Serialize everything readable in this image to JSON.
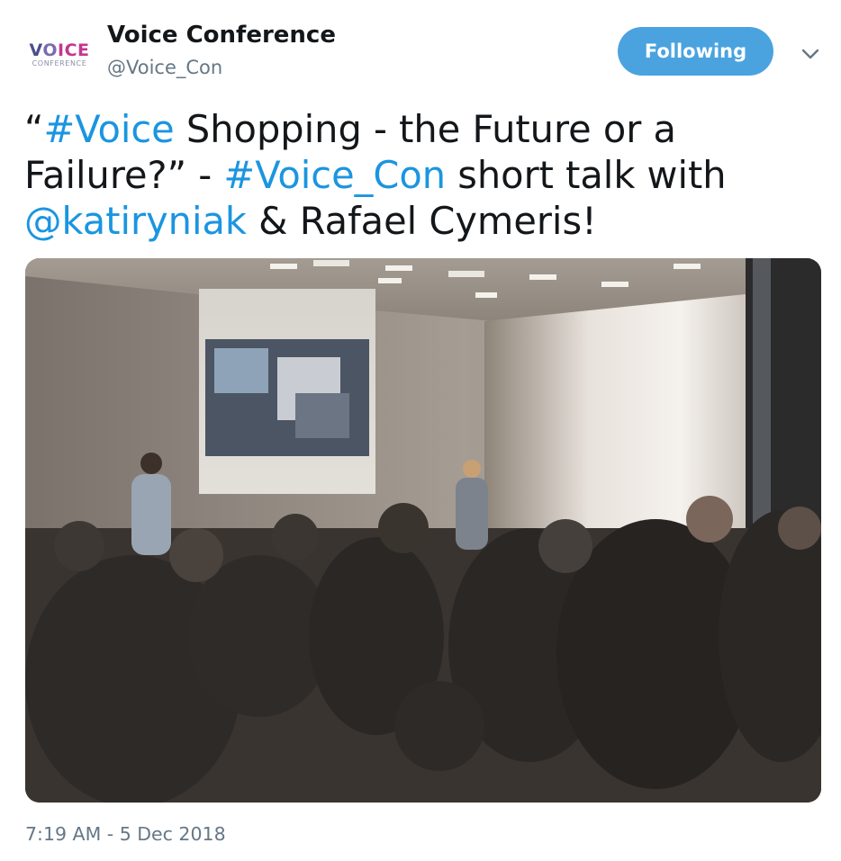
{
  "author": {
    "display_name": "Voice Conference",
    "handle": "@Voice_Con",
    "avatar": {
      "logo_word_1": "V",
      "logo_word_2": "O",
      "logo_word_3": "ICE",
      "logo_sub": "CONFERENCE"
    }
  },
  "follow_button": {
    "label": "Following",
    "color": "#4aa3df"
  },
  "menu": {
    "icon": "chevron-down-icon"
  },
  "tweet": {
    "segments": [
      {
        "text": "“",
        "link": false
      },
      {
        "text": "#Voice",
        "link": true
      },
      {
        "text": " Shopping - the Future or a Failure?” - ",
        "link": false
      },
      {
        "text": "#Voice_Con",
        "link": true
      },
      {
        "text": " short talk with ",
        "link": false
      },
      {
        "text": "@katiryniak",
        "link": true
      },
      {
        "text": " & Rafael Cymeris!",
        "link": false
      }
    ],
    "link_color": "#1b95e0"
  },
  "photo": {
    "icon": "conference-photo"
  },
  "timestamp": "7:19 AM - 5 Dec 2018"
}
